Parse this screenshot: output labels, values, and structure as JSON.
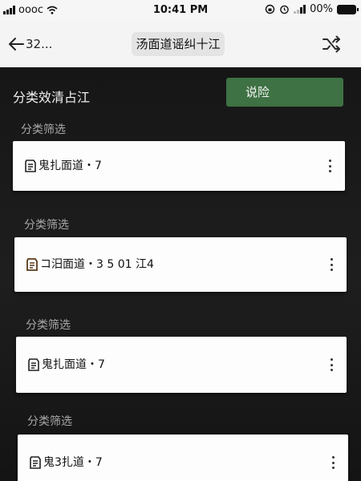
{
  "status_bar": {
    "carrier": "oooc",
    "time": "10:41 PM",
    "battery": "00%"
  },
  "nav": {
    "back_label": "32...",
    "title": "汤面道谣纠十江",
    "shuffle_icon": "shuffle-icon"
  },
  "filter_header": {
    "title": "分类效清占江",
    "confirm_label": "说险",
    "confirm_color": "#3e7143"
  },
  "sections": [
    {
      "label": "分类筛选",
      "item_text": "鬼扎面道・7"
    },
    {
      "label": "分类筛选",
      "item_text": "コ汨面道・3 5 01 江4"
    },
    {
      "label": "分类筛选",
      "item_text": "鬼扎面道・7"
    },
    {
      "label": "分类筛选",
      "item_text": "鬼3扎道・7"
    }
  ]
}
